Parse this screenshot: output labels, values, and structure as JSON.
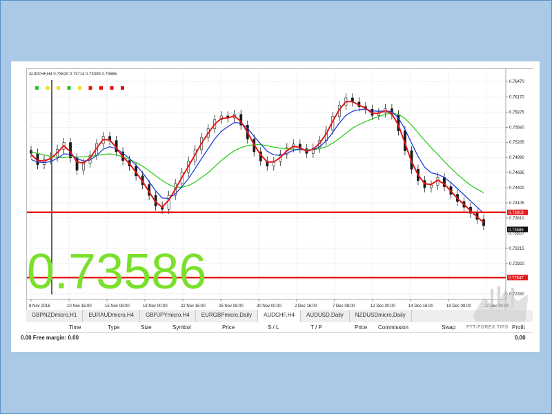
{
  "chart_header": {
    "title": "AUDCHF,H4  0.73620 0.73714 0.73309 0.73586"
  },
  "big_price": "0.73586",
  "indicator_squares": [
    "#22c42a",
    "#f0e020",
    "#f0e020",
    "#22c42a",
    "#f0e020",
    "#e01010",
    "#e01010",
    "#e01010",
    "#e01010"
  ],
  "colors": {
    "fast_ma": "#e01818",
    "mid_ma": "#1f3fd6",
    "slow_ma": "#33cc22",
    "level_line": "#e51b1b",
    "big_price": "#7be02c"
  },
  "chart_data": {
    "type": "line",
    "symbol": "AUDCHF",
    "timeframe": "H4",
    "y_axis": {
      "ticks": [
        "0.76470",
        "0.76170",
        "0.75875",
        "0.75580",
        "0.75285",
        "0.74990",
        "0.74695",
        "0.74400",
        "0.74105",
        "0.73810",
        "0.73215",
        "0.72920",
        "0.72330"
      ],
      "range": [
        0.7222,
        0.7658
      ]
    },
    "x_axis": {
      "ticks": [
        "8 Nov 2016",
        "10 Nov 16:00",
        "15 Nov 08:00",
        "18 Nov 00:00",
        "22 Nov 16:00",
        "25 Nov 08:00",
        "30 Nov 00:00",
        "2 Dec 16:00",
        "7 Dec 08:00",
        "12 Dec 00:00",
        "14 Dec 16:00",
        "19 Dec 08:00",
        "22 Dec 00:00"
      ]
    },
    "price_labels": {
      "upper_level": "0.73919",
      "current": "0.73586",
      "lower_level": "0.72647",
      "partial": "0.73510"
    },
    "levels": [
      0.73919,
      0.72647
    ],
    "close_series": [
      0.7507,
      0.7485,
      0.7495,
      0.75,
      0.7515,
      0.7528,
      0.7498,
      0.7474,
      0.7488,
      0.7503,
      0.7526,
      0.754,
      0.7532,
      0.751,
      0.7493,
      0.7482,
      0.7463,
      0.7446,
      0.7425,
      0.7404,
      0.7398,
      0.7425,
      0.7448,
      0.747,
      0.7492,
      0.7514,
      0.7538,
      0.7555,
      0.7573,
      0.758,
      0.7576,
      0.7583,
      0.7562,
      0.7535,
      0.751,
      0.7492,
      0.7482,
      0.7491,
      0.7505,
      0.7518,
      0.7525,
      0.7516,
      0.7507,
      0.7517,
      0.7532,
      0.7552,
      0.7579,
      0.7601,
      0.7615,
      0.7607,
      0.7598,
      0.7593,
      0.7581,
      0.7586,
      0.7594,
      0.7582,
      0.7551,
      0.7512,
      0.7476,
      0.7454,
      0.744,
      0.7445,
      0.746,
      0.7442,
      0.7427,
      0.7413,
      0.7402,
      0.739,
      0.7378,
      0.7366
    ],
    "fast_ma": [
      0.7505,
      0.7493,
      0.7492,
      0.7497,
      0.7508,
      0.7522,
      0.751,
      0.749,
      0.7488,
      0.7498,
      0.7517,
      0.7534,
      0.7533,
      0.7518,
      0.75,
      0.7487,
      0.747,
      0.7452,
      0.7432,
      0.7412,
      0.7402,
      0.7416,
      0.7437,
      0.746,
      0.7482,
      0.7504,
      0.7527,
      0.7546,
      0.7564,
      0.7575,
      0.7576,
      0.758,
      0.7569,
      0.7548,
      0.7524,
      0.7504,
      0.749,
      0.749,
      0.7499,
      0.7512,
      0.7521,
      0.7518,
      0.7511,
      0.7515,
      0.7527,
      0.7545,
      0.757,
      0.7592,
      0.7608,
      0.7608,
      0.7601,
      0.7595,
      0.7585,
      0.7585,
      0.759,
      0.7584,
      0.7562,
      0.7527,
      0.7491,
      0.7465,
      0.7448,
      0.7446,
      0.7455,
      0.7447,
      0.7433,
      0.7419,
      0.7407,
      0.7395,
      0.7383,
      0.7372
    ],
    "mid_ma": [
      0.7495,
      0.749,
      0.7489,
      0.7491,
      0.7497,
      0.7506,
      0.7505,
      0.7497,
      0.7492,
      0.7494,
      0.7503,
      0.7515,
      0.752,
      0.7516,
      0.7507,
      0.7497,
      0.7484,
      0.7469,
      0.7452,
      0.7434,
      0.742,
      0.7419,
      0.7428,
      0.7442,
      0.7458,
      0.7477,
      0.7497,
      0.7516,
      0.7535,
      0.755,
      0.7559,
      0.7567,
      0.7566,
      0.7556,
      0.754,
      0.7525,
      0.7511,
      0.7504,
      0.7503,
      0.7507,
      0.7513,
      0.7515,
      0.7513,
      0.7514,
      0.752,
      0.7531,
      0.7548,
      0.7566,
      0.7581,
      0.7589,
      0.7592,
      0.7593,
      0.759,
      0.7589,
      0.759,
      0.7588,
      0.7576,
      0.7554,
      0.7527,
      0.7501,
      0.748,
      0.7469,
      0.7466,
      0.746,
      0.745,
      0.7438,
      0.7426,
      0.7414,
      0.7402,
      0.739
    ],
    "slow_ma": [
      0.751,
      0.7507,
      0.7504,
      0.7501,
      0.7499,
      0.7499,
      0.75,
      0.75,
      0.75,
      0.7501,
      0.7503,
      0.7505,
      0.7506,
      0.7504,
      0.75,
      0.7495,
      0.7489,
      0.7482,
      0.7473,
      0.7463,
      0.7454,
      0.7446,
      0.7441,
      0.7441,
      0.7444,
      0.7451,
      0.746,
      0.7469,
      0.7481,
      0.7493,
      0.7503,
      0.7512,
      0.7518,
      0.7522,
      0.7524,
      0.7524,
      0.7522,
      0.7519,
      0.7517,
      0.7516,
      0.7515,
      0.7514,
      0.7514,
      0.7514,
      0.7516,
      0.752,
      0.7527,
      0.7536,
      0.7546,
      0.7556,
      0.7563,
      0.7569,
      0.7574,
      0.7579,
      0.7583,
      0.7586,
      0.7583,
      0.7575,
      0.7562,
      0.7547,
      0.7532,
      0.7518,
      0.7505,
      0.7491,
      0.7478,
      0.7466,
      0.7455,
      0.7445,
      0.7437,
      0.743
    ]
  },
  "symbol_tabs": [
    "GBPNZDmicro,H1",
    "EURAUDmicro,H4",
    "GBPJPYmicro,H4",
    "EURGBPmicro,Daily",
    "AUDCHF,H4",
    "AUDUSD,Daily",
    "NZDUSDmicro,Daily"
  ],
  "active_tab_index": 4,
  "terminal": {
    "columns": [
      "Time",
      "Type",
      "Size",
      "Symbol",
      "Price",
      "S / L",
      "T / P",
      "Price",
      "Commission",
      "Swap",
      "Profit"
    ],
    "balance_row": "0.00  Free margin: 0.00",
    "profit_total": "0.00"
  },
  "watermark": {
    "text": "FTT-FOREX TIPS"
  }
}
